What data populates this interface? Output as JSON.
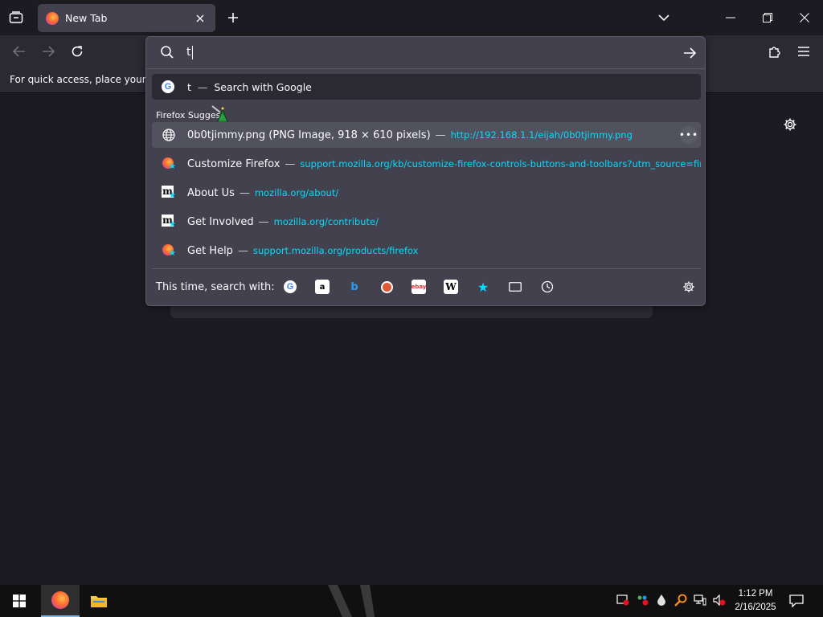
{
  "tab": {
    "title": "New Tab"
  },
  "bookmarks_bar": {
    "text": "For quick access, place your boo"
  },
  "urlbar": {
    "value": "t",
    "heuristic": {
      "query": "t",
      "separator": "—",
      "action": "Search with Google"
    },
    "group_label": "Firefox Suggest",
    "results": [
      {
        "icon": "globe-icon",
        "title": "0b0tjimmy.png (PNG Image, 918 × 610 pixels)",
        "url": "http://192.168.1.1/eijah/0b0tjimmy.png"
      },
      {
        "icon": "firefox-bookmark-icon",
        "title": "Customize Firefox",
        "url": "support.mozilla.org/kb/customize-firefox-controls-buttons-and-toolbars?utm_source=firefo"
      },
      {
        "icon": "mozilla-bookmark-icon",
        "title": "About Us",
        "url": "mozilla.org/about/"
      },
      {
        "icon": "mozilla-bookmark-icon",
        "title": "Get Involved",
        "url": "mozilla.org/contribute/"
      },
      {
        "icon": "firefox-bookmark-icon",
        "title": "Get Help",
        "url": "support.mozilla.org/products/firefox"
      }
    ],
    "dash": "—",
    "footer_label": "This time, search with:",
    "engines": [
      "google-icon",
      "amazon-icon",
      "bing-icon",
      "duckduckgo-icon",
      "ebay-icon",
      "wikipedia-icon",
      "bookmarks-star-icon",
      "tabs-icon",
      "history-icon"
    ]
  },
  "taskbar": {
    "time": "1:12 PM",
    "date": "2/16/2025"
  },
  "colors": {
    "accent": "#00ddff",
    "popup_bg": "#42414d",
    "selected_bg": "#52525e",
    "page_bg": "#1c1b22"
  }
}
